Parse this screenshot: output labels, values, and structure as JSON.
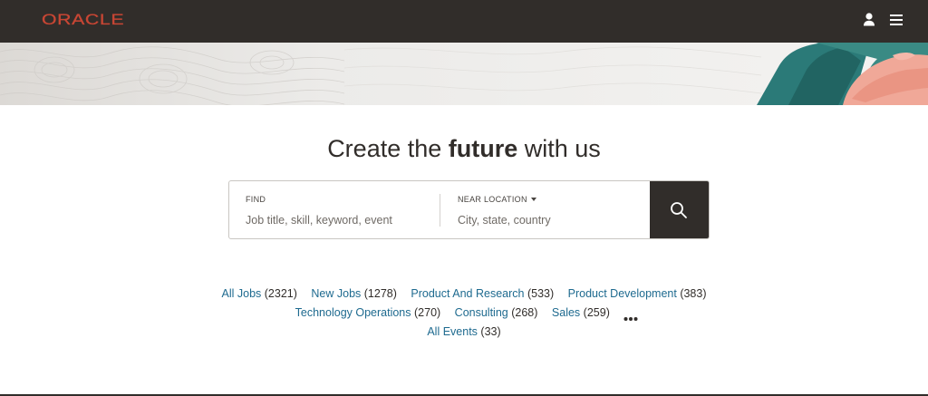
{
  "header": {
    "logo_text": "ORACLE",
    "logo_color": "#c74634",
    "background": "#312d2a",
    "icons": [
      "user-icon",
      "hamburger-menu-icon"
    ]
  },
  "hero": {
    "title_part1": "Create the ",
    "title_bold": "future",
    "title_part2": " with us"
  },
  "search": {
    "find_label": "FIND",
    "find_placeholder": "Job title, skill, keyword, event",
    "location_label": "NEAR LOCATION",
    "location_placeholder": "City, state, country",
    "button_icon": "search-icon"
  },
  "categories": {
    "row1": [
      {
        "label": "All Jobs",
        "count": "(2321)"
      },
      {
        "label": "New Jobs",
        "count": "(1278)"
      },
      {
        "label": "Product And Research",
        "count": "(533)"
      },
      {
        "label": "Product Development",
        "count": "(383)"
      }
    ],
    "row2": [
      {
        "label": "Technology Operations",
        "count": "(270)"
      },
      {
        "label": "Consulting",
        "count": "(268)"
      },
      {
        "label": "Sales",
        "count": "(259)"
      }
    ],
    "row3": [
      {
        "label": "All Events",
        "count": "(33)"
      }
    ],
    "more_icon": "more-dots-icon",
    "link_color": "#1e6a8f"
  }
}
